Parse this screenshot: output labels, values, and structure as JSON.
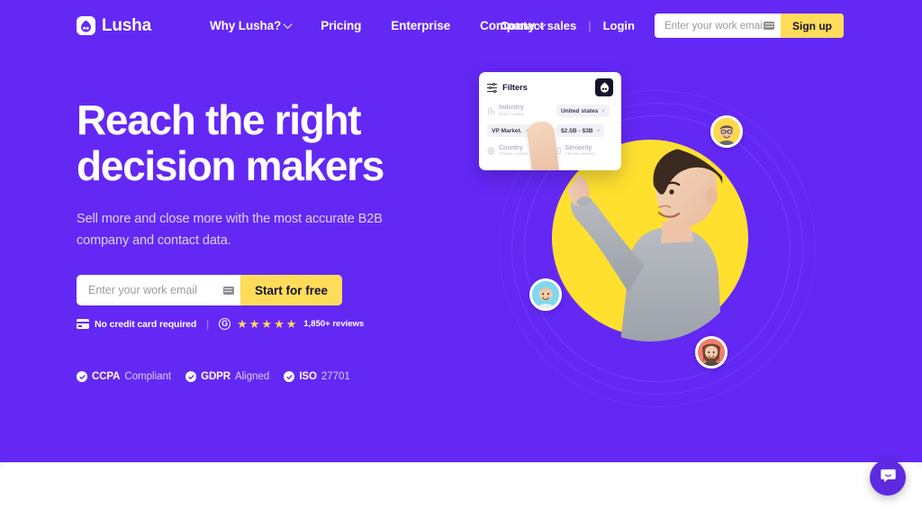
{
  "brand": {
    "name": "Lusha",
    "purple": "#6428f5",
    "yellow": "#ffdc5a",
    "accent_yellow": "#ffe02e",
    "dark": "#14132b"
  },
  "nav": {
    "logo_label": "Lusha",
    "logo_icon": "lusha-flame-icon",
    "links": [
      {
        "label": "Why Lusha?",
        "has_caret": true
      },
      {
        "label": "Pricing",
        "has_caret": false
      },
      {
        "label": "Enterprise",
        "has_caret": false
      },
      {
        "label": "Company",
        "has_caret": true
      }
    ],
    "contact_sales": "Contact sales",
    "separator": "|",
    "login": "Login",
    "email_placeholder": "Enter your work email",
    "email_value": "",
    "autofill_icon": "keyboard-autofill-icon",
    "signup_label": "Sign up"
  },
  "hero": {
    "headline_line1": "Reach the right",
    "headline_line2": "decision makers",
    "subhead_line1": "Sell more and close more with the most accurate B2B",
    "subhead_line2": "company and contact data.",
    "cta": {
      "email_placeholder": "Enter your work email",
      "email_value": "",
      "autofill_icon": "keyboard-autofill-icon",
      "button_label": "Start for free"
    },
    "trust": {
      "no_credit_card": "No credit card required",
      "card_icon": "credit-card-icon",
      "separator": "|",
      "g2_logo": "G",
      "stars": [
        "★",
        "★",
        "★",
        "★",
        "★"
      ],
      "star_count": 5,
      "reviews": "1,850+ reviews"
    },
    "compliance": [
      {
        "strong": "CCPA",
        "light": "Compliant"
      },
      {
        "strong": "GDPR",
        "light": "Aligned"
      },
      {
        "strong": "ISO",
        "light": "27701"
      }
    ]
  },
  "filters_card": {
    "title": "Filters",
    "title_icon": "sliders-icon",
    "brand_icon": "lusha-app-icon",
    "fields": [
      {
        "label": "Industry",
        "sub": "Enter industry",
        "icon": "building-icon"
      },
      {
        "label": "Country",
        "sub": "Choose country",
        "icon": "globe-icon"
      },
      {
        "label": "Seniority",
        "sub": "Choose seniority",
        "icon": "badge-icon"
      }
    ],
    "chips": [
      {
        "text": "United states",
        "remove": "×"
      },
      {
        "text": "VP Market.",
        "remove": "×"
      },
      {
        "text": "$2.5B - $3B",
        "remove": "×"
      }
    ]
  },
  "art": {
    "yellow_circle": "yellow-circle-backdrop",
    "person": "person-pointing-photo",
    "avatars": [
      {
        "name": "avatar-top-right",
        "bg": "#ffd84d"
      },
      {
        "name": "avatar-left",
        "bg": "#7ed8f2"
      },
      {
        "name": "avatar-bottom-right",
        "bg": "#f07f6d"
      }
    ],
    "rings": 3
  },
  "chat": {
    "icon": "chat-bubble-icon",
    "label": "Open chat"
  }
}
